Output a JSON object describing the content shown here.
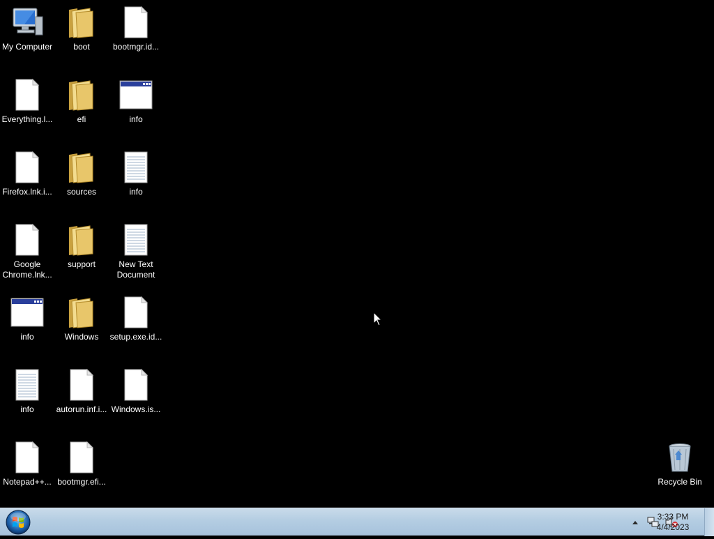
{
  "desktop": {
    "icons": [
      {
        "label": "My Computer",
        "type": "computer"
      },
      {
        "label": "boot",
        "type": "folder"
      },
      {
        "label": "bootmgr.id...",
        "type": "file"
      },
      {
        "label": "Everything.l...",
        "type": "file"
      },
      {
        "label": "efi",
        "type": "folder"
      },
      {
        "label": "info",
        "type": "window"
      },
      {
        "label": "Firefox.lnk.i...",
        "type": "file"
      },
      {
        "label": "sources",
        "type": "folder"
      },
      {
        "label": "info",
        "type": "textfile"
      },
      {
        "label": "Google Chrome.lnk...",
        "type": "file"
      },
      {
        "label": "support",
        "type": "folder"
      },
      {
        "label": "New Text Document",
        "type": "textfile"
      },
      {
        "label": "info",
        "type": "window"
      },
      {
        "label": "Windows",
        "type": "folder"
      },
      {
        "label": "setup.exe.id...",
        "type": "file"
      },
      {
        "label": "info",
        "type": "textfile"
      },
      {
        "label": "autorun.inf.i...",
        "type": "file"
      },
      {
        "label": "Windows.is...",
        "type": "file"
      },
      {
        "label": "Notepad++...",
        "type": "file"
      },
      {
        "label": "bootmgr.efi...",
        "type": "file"
      }
    ],
    "recycle_bin": {
      "label": "Recycle Bin",
      "type": "recycle-bin"
    }
  },
  "taskbar": {
    "start_icon": "windows-start-orb-icon",
    "tray_icons": [
      "show-hidden-icons-icon",
      "network-icon",
      "volume-muted-icon"
    ],
    "clock": {
      "time": "3:33 PM",
      "date": "4/4/2023"
    }
  },
  "colors": {
    "desktop_background": "#000000",
    "taskbar": "#b4cde2",
    "folder": "#e8c66a",
    "window_titlebar": "#2a3f9c"
  }
}
